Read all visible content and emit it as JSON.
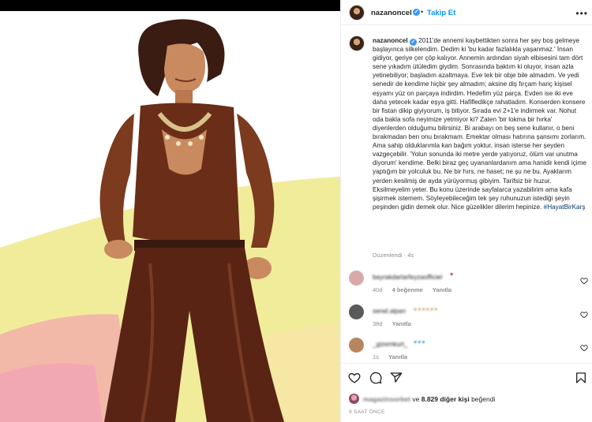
{
  "post": {
    "username": "nazanoncel",
    "follow_separator": "•",
    "follow_label": "Takip Et",
    "more_label": "•••"
  },
  "caption": {
    "username": "nazanoncel",
    "text": "2011'de annemi kaybettikten sonra her şey boş gelmeye başlayınca silkelendim. Dedim ki 'bu kadar fazlalıkla yaşanmaz.' İnsan gidiyor, geriye çer çöp kalıyor. Annemin ardından siyah elbisesini tam dört sene yıkadım ütüledim giydim. Sonrasında baktım ki oluyor, insan azla yetinebiliyor; başladım azaltmaya. Eve tek bir obje bile almadım. Ve yedi senedir de kendime hiçbir şey almadım; aksine diş fırçam hariç kişisel eşyamı yüz on parçaya indirdim. Hedefim yüz parça. Evden ise iki eve daha yetecek kadar eşya gitti. Hafifledikçe rahatladım. Konserden konsere bir fistan dikip giyiyorum, iş bitiyor. Sırada evi 2+1'e indirmek var. Nohut oda bakla sofa neyimize yetmiyor ki? Zaten 'bir lokma bir hırka' diyenlerden olduğumu bilirsiniz. Bi arabayı on beş sene kullanır, o beni bırakmadan ben onu bırakmam. Emektar olması hatırına şansımı zorlarım. Ama sahip olduklarımla kan bağım yoktur, insan isterse her şeyden vazgeçebilir. 'Yolun sonunda iki metre yerde yatıyoruz, ölüm var unutma diyorum' kendime. Belki biraz geç uyananlardanım ama hanidir kendi içime yaptığım bir yolculuk bu. Ne bir hırs, ne haset; ne şu ne bu. Ayaklarım yerden kesilmiş de ayda yürüyormuş gibiyim. Tarifsiz bir huzur. Eksilmeyelim yeter. Bu konu üzerinde sayfalarca yazabilirim ama kafa şişirmek istemem. Söyleyebileceğim tek şey ruhunuzun istediği şeyin peşinden gidin demek olur. Nice güzelikler dilerim hepinize.",
    "hashtag": "#HayatBirKarş",
    "edited_label": "Düzenlendi",
    "separator": "·",
    "age": "4s"
  },
  "comments": [
    {
      "username_blurred": "bayrakdarlarfeyzaofficiel",
      "time": "40d",
      "likes": "4 beğenme",
      "reply": "Yanıtla",
      "avatar_color": "#d9a9a9"
    },
    {
      "username_blurred": "senel.alpan",
      "time": "38d",
      "reply": "Yanıtla",
      "avatar_color": "#5a5a5a"
    },
    {
      "username_blurred": "_gizemkurt_",
      "time": "1s",
      "reply": "Yanıtla",
      "avatar_color": "#b7865f"
    }
  ],
  "likes": {
    "liker_blurred": "magazinsorbet",
    "connector": "ve",
    "count_label": "8.829 diğer kişi",
    "suffix": "beğendi"
  },
  "timestamp": "9 SAAT ÖNCE",
  "icons": [
    "verified-icon",
    "heart-icon",
    "comment-icon",
    "share-icon",
    "bookmark-icon",
    "more-icon"
  ]
}
